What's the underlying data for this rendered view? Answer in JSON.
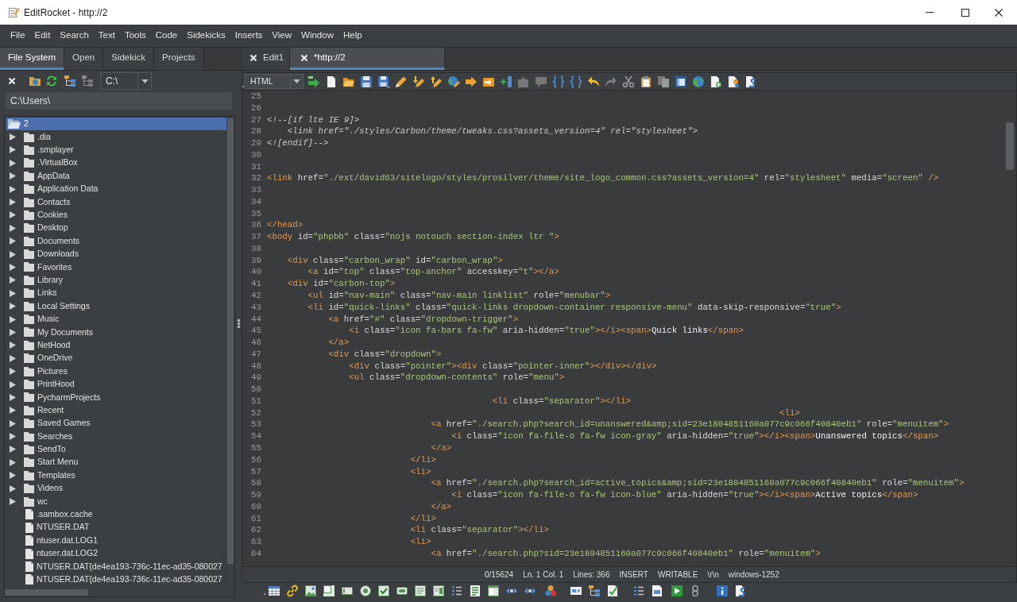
{
  "window": {
    "title": "EditRocket - http://2"
  },
  "menu": [
    "File",
    "Edit",
    "Search",
    "Text",
    "Tools",
    "Code",
    "Sidekicks",
    "Inserts",
    "View",
    "Window",
    "Help"
  ],
  "panel_tabs": [
    {
      "label": "File System",
      "selected": true
    },
    {
      "label": "Open",
      "selected": false
    },
    {
      "label": "Sidekick",
      "selected": false
    },
    {
      "label": "Projects",
      "selected": false
    }
  ],
  "editor_tabs": [
    {
      "label": "Edit1",
      "selected": false
    },
    {
      "label": "*http://2",
      "selected": true
    }
  ],
  "file_panel": {
    "drive": "C:\\",
    "path": "C:\\Users\\",
    "root": {
      "label": "2",
      "expanded": true,
      "selected": true,
      "children": [
        {
          "label": ".dia",
          "kind": "folder",
          "expanded": false,
          "selected": false
        },
        {
          "label": ".smplayer",
          "kind": "folder",
          "expanded": false,
          "selected": false
        },
        {
          "label": ".VirtualBox",
          "kind": "folder",
          "expanded": false,
          "selected": false
        },
        {
          "label": "AppData",
          "kind": "folder",
          "expanded": false,
          "selected": false
        },
        {
          "label": "Application Data",
          "kind": "folder",
          "expanded": false,
          "selected": false
        },
        {
          "label": "Contacts",
          "kind": "folder",
          "expanded": false,
          "selected": false
        },
        {
          "label": "Cookies",
          "kind": "folder",
          "expanded": false,
          "selected": false
        },
        {
          "label": "Desktop",
          "kind": "folder",
          "expanded": false,
          "selected": false
        },
        {
          "label": "Documents",
          "kind": "folder",
          "expanded": false,
          "selected": false
        },
        {
          "label": "Downloads",
          "kind": "folder",
          "expanded": false,
          "selected": false
        },
        {
          "label": "Favorites",
          "kind": "folder",
          "expanded": false,
          "selected": false
        },
        {
          "label": "Library",
          "kind": "folder",
          "expanded": false,
          "selected": false
        },
        {
          "label": "Links",
          "kind": "folder",
          "expanded": false,
          "selected": false
        },
        {
          "label": "Local Settings",
          "kind": "folder",
          "expanded": false,
          "selected": false
        },
        {
          "label": "Music",
          "kind": "folder",
          "expanded": false,
          "selected": false
        },
        {
          "label": "My Documents",
          "kind": "folder",
          "expanded": false,
          "selected": false
        },
        {
          "label": "NetHood",
          "kind": "folder",
          "expanded": false,
          "selected": false
        },
        {
          "label": "OneDrive",
          "kind": "folder",
          "expanded": false,
          "selected": false
        },
        {
          "label": "Pictures",
          "kind": "folder",
          "expanded": false,
          "selected": false
        },
        {
          "label": "PrintHood",
          "kind": "folder",
          "expanded": false,
          "selected": false
        },
        {
          "label": "PycharmProjects",
          "kind": "folder",
          "expanded": false,
          "selected": false
        },
        {
          "label": "Recent",
          "kind": "folder",
          "expanded": false,
          "selected": false
        },
        {
          "label": "Saved Games",
          "kind": "folder",
          "expanded": false,
          "selected": false
        },
        {
          "label": "Searches",
          "kind": "folder",
          "expanded": false,
          "selected": false
        },
        {
          "label": "SendTo",
          "kind": "folder",
          "expanded": false,
          "selected": false
        },
        {
          "label": "Start Menu",
          "kind": "folder",
          "expanded": false,
          "selected": false
        },
        {
          "label": "Templates",
          "kind": "folder",
          "expanded": false,
          "selected": false
        },
        {
          "label": "Videos",
          "kind": "folder",
          "expanded": false,
          "selected": false
        },
        {
          "label": "wc",
          "kind": "folder",
          "expanded": false,
          "selected": false
        },
        {
          "label": ".sambox.cache",
          "kind": "file",
          "selected": false
        },
        {
          "label": "NTUSER.DAT",
          "kind": "file",
          "selected": false
        },
        {
          "label": "ntuser.dat.LOG1",
          "kind": "file",
          "selected": false
        },
        {
          "label": "ntuser.dat.LOG2",
          "kind": "file",
          "selected": false
        },
        {
          "label": "NTUSER.DAT{de4ea193-736c-11ec-ad35-080027",
          "kind": "file",
          "selected": false
        },
        {
          "label": "NTUSER.DAT{de4ea193-736c-11ec-ad35-080027",
          "kind": "file",
          "selected": false
        }
      ]
    }
  },
  "editor": {
    "language": "HTML",
    "lines": [
      {
        "number": "25"
      },
      {
        "number": "26"
      },
      {
        "number": "27",
        "tokens": [
          {
            "kind": "comment",
            "text": "<!--[if lte IE 9]>"
          }
        ]
      },
      {
        "number": "28",
        "tokens": [
          {
            "kind": "comment",
            "text": "\t<link href=\"./styles/Carbon/theme/tweaks.css?assets_version=4\" rel=\"stylesheet\">"
          }
        ]
      },
      {
        "number": "29",
        "tokens": [
          {
            "kind": "comment",
            "text": "<![endif]-->"
          }
        ]
      },
      {
        "number": "30"
      },
      {
        "number": "31"
      },
      {
        "number": "32",
        "tokens": [
          {
            "kind": "tag",
            "text": "<link"
          },
          {
            "kind": "attr",
            "text": " href="
          },
          {
            "kind": "value",
            "text": "\"./ext/david63/sitelogo/styles/prosilver/theme/site_logo_common.css?assets_version=4\""
          },
          {
            "kind": "attr",
            "text": " rel="
          },
          {
            "kind": "value",
            "text": "\"stylesheet\""
          },
          {
            "kind": "attr",
            "text": " media="
          },
          {
            "kind": "value",
            "text": "\"screen\""
          },
          {
            "kind": "tag",
            "text": " />"
          }
        ]
      },
      {
        "number": "33"
      },
      {
        "number": "34"
      },
      {
        "number": "35"
      },
      {
        "number": "36",
        "tokens": [
          {
            "kind": "tag",
            "text": "</head>"
          }
        ]
      },
      {
        "number": "37",
        "tokens": [
          {
            "kind": "tag",
            "text": "<body"
          },
          {
            "kind": "attr",
            "text": " id="
          },
          {
            "kind": "value",
            "text": "\"phpbb\""
          },
          {
            "kind": "attr",
            "text": " class="
          },
          {
            "kind": "value",
            "text": "\"nojs notouch section-index ltr \""
          },
          {
            "kind": "tag",
            "text": ">"
          }
        ]
      },
      {
        "number": "38"
      },
      {
        "number": "39",
        "tokens": [
          {
            "kind": "tag",
            "text": "\t<div"
          },
          {
            "kind": "attr",
            "text": " class="
          },
          {
            "kind": "value",
            "text": "\"carbon_wrap\""
          },
          {
            "kind": "attr",
            "text": " id="
          },
          {
            "kind": "value",
            "text": "\"carbon_wrap\""
          },
          {
            "kind": "tag",
            "text": ">"
          }
        ]
      },
      {
        "number": "40",
        "tokens": [
          {
            "kind": "tag",
            "text": "\t\t<a"
          },
          {
            "kind": "attr",
            "text": " id="
          },
          {
            "kind": "value",
            "text": "\"top\""
          },
          {
            "kind": "attr",
            "text": " class="
          },
          {
            "kind": "value",
            "text": "\"top-anchor\""
          },
          {
            "kind": "attr",
            "text": " accesskey="
          },
          {
            "kind": "value",
            "text": "\"t\""
          },
          {
            "kind": "tag",
            "text": "></a>"
          }
        ]
      },
      {
        "number": "41",
        "tokens": [
          {
            "kind": "tag",
            "text": "\t<div"
          },
          {
            "kind": "attr",
            "text": " id="
          },
          {
            "kind": "value",
            "text": "\"carbon-top\""
          },
          {
            "kind": "tag",
            "text": ">"
          }
        ]
      },
      {
        "number": "42",
        "tokens": [
          {
            "kind": "tag",
            "text": "\t\t<ul"
          },
          {
            "kind": "attr",
            "text": " id="
          },
          {
            "kind": "value",
            "text": "\"nav-main\""
          },
          {
            "kind": "attr",
            "text": " class="
          },
          {
            "kind": "value",
            "text": "\"nav-main linklist\""
          },
          {
            "kind": "attr",
            "text": " role="
          },
          {
            "kind": "value",
            "text": "\"menubar\""
          },
          {
            "kind": "tag",
            "text": ">"
          }
        ]
      },
      {
        "number": "43",
        "tokens": [
          {
            "kind": "tag",
            "text": "\t\t<li"
          },
          {
            "kind": "attr",
            "text": " id="
          },
          {
            "kind": "value",
            "text": "\"quick-links\""
          },
          {
            "kind": "attr",
            "text": " class="
          },
          {
            "kind": "value",
            "text": "\"quick-links dropdown-container responsive-menu\""
          },
          {
            "kind": "attr",
            "text": " data-skip-responsive="
          },
          {
            "kind": "value",
            "text": "\"true\""
          },
          {
            "kind": "tag",
            "text": ">"
          }
        ]
      },
      {
        "number": "44",
        "tokens": [
          {
            "kind": "tag",
            "text": "\t\t\t<a"
          },
          {
            "kind": "attr",
            "text": " href="
          },
          {
            "kind": "value",
            "text": "\"#\""
          },
          {
            "kind": "attr",
            "text": " class="
          },
          {
            "kind": "value",
            "text": "\"dropdown-trigger\""
          },
          {
            "kind": "tag",
            "text": ">"
          }
        ]
      },
      {
        "number": "45",
        "tokens": [
          {
            "kind": "tag",
            "text": "\t\t\t\t<i"
          },
          {
            "kind": "attr",
            "text": " class="
          },
          {
            "kind": "value",
            "text": "\"icon fa-bars fa-fw\""
          },
          {
            "kind": "attr",
            "text": " aria-hidden="
          },
          {
            "kind": "value",
            "text": "\"true\""
          },
          {
            "kind": "tag",
            "text": "></i><span>"
          },
          {
            "kind": "text",
            "text": "Quick links"
          },
          {
            "kind": "tag",
            "text": "</span>"
          }
        ]
      },
      {
        "number": "46",
        "tokens": [
          {
            "kind": "tag",
            "text": "\t\t\t</a>"
          }
        ]
      },
      {
        "number": "47",
        "tokens": [
          {
            "kind": "tag",
            "text": "\t\t\t<div"
          },
          {
            "kind": "attr",
            "text": " class="
          },
          {
            "kind": "value",
            "text": "\"dropdown\""
          },
          {
            "kind": "tag",
            "text": ">"
          }
        ]
      },
      {
        "number": "48",
        "tokens": [
          {
            "kind": "tag",
            "text": "\t\t\t\t<div"
          },
          {
            "kind": "attr",
            "text": " class="
          },
          {
            "kind": "value",
            "text": "\"pointer\""
          },
          {
            "kind": "tag",
            "text": "><div"
          },
          {
            "kind": "attr",
            "text": " class="
          },
          {
            "kind": "value",
            "text": "\"pointer-inner\""
          },
          {
            "kind": "tag",
            "text": "></div></div>"
          }
        ]
      },
      {
        "number": "49",
        "tokens": [
          {
            "kind": "tag",
            "text": "\t\t\t\t<ul"
          },
          {
            "kind": "attr",
            "text": " class="
          },
          {
            "kind": "value",
            "text": "\"dropdown-contents\""
          },
          {
            "kind": "attr",
            "text": " role="
          },
          {
            "kind": "value",
            "text": "\"menu\""
          },
          {
            "kind": "tag",
            "text": ">"
          }
        ]
      },
      {
        "number": "50"
      },
      {
        "number": "51",
        "tokens": [
          {
            "kind": "tag",
            "text": "\t\t\t\t\t\t\t\t\t\t\t<li"
          },
          {
            "kind": "attr",
            "text": " class="
          },
          {
            "kind": "value",
            "text": "\"separator\""
          },
          {
            "kind": "tag",
            "text": "></li>"
          }
        ]
      },
      {
        "number": "52",
        "tokens": [
          {
            "kind": "tag",
            "text": "\t\t\t\t\t\t\t\t\t\t\t\t\t\t\t\t\t\t\t\t\t\t\t\t\t<li>"
          }
        ]
      },
      {
        "number": "53",
        "tokens": [
          {
            "kind": "tag",
            "text": "\t\t\t\t\t\t\t\t<a"
          },
          {
            "kind": "attr",
            "text": " href="
          },
          {
            "kind": "value",
            "text": "\"./search.php?search_id=unanswered&amp;sid=23e1804851160a077c9c066f40840eb1\""
          },
          {
            "kind": "attr",
            "text": " role="
          },
          {
            "kind": "value",
            "text": "\"menuitem\""
          },
          {
            "kind": "tag",
            "text": ">"
          }
        ]
      },
      {
        "number": "54",
        "tokens": [
          {
            "kind": "tag",
            "text": "\t\t\t\t\t\t\t\t\t<i"
          },
          {
            "kind": "attr",
            "text": " class="
          },
          {
            "kind": "value",
            "text": "\"icon fa-file-o fa-fw icon-gray\""
          },
          {
            "kind": "attr",
            "text": " aria-hidden="
          },
          {
            "kind": "value",
            "text": "\"true\""
          },
          {
            "kind": "tag",
            "text": "></i><span>"
          },
          {
            "kind": "text",
            "text": "Unanswered topics"
          },
          {
            "kind": "tag",
            "text": "</span>"
          }
        ]
      },
      {
        "number": "55",
        "tokens": [
          {
            "kind": "tag",
            "text": "\t\t\t\t\t\t\t\t</a>"
          }
        ]
      },
      {
        "number": "56",
        "tokens": [
          {
            "kind": "tag",
            "text": "\t\t\t\t\t\t\t</li>"
          }
        ]
      },
      {
        "number": "57",
        "tokens": [
          {
            "kind": "tag",
            "text": "\t\t\t\t\t\t\t<li>"
          }
        ]
      },
      {
        "number": "58",
        "tokens": [
          {
            "kind": "tag",
            "text": "\t\t\t\t\t\t\t\t<a"
          },
          {
            "kind": "attr",
            "text": " href="
          },
          {
            "kind": "value",
            "text": "\"./search.php?search_id=active_topics&amp;sid=23e1804851160a077c9c066f40840eb1\""
          },
          {
            "kind": "attr",
            "text": " role="
          },
          {
            "kind": "value",
            "text": "\"menuitem\""
          },
          {
            "kind": "tag",
            "text": ">"
          }
        ]
      },
      {
        "number": "59",
        "tokens": [
          {
            "kind": "tag",
            "text": "\t\t\t\t\t\t\t\t\t<i"
          },
          {
            "kind": "attr",
            "text": " class="
          },
          {
            "kind": "value",
            "text": "\"icon fa-file-o fa-fw icon-blue\""
          },
          {
            "kind": "attr",
            "text": " aria-hidden="
          },
          {
            "kind": "value",
            "text": "\"true\""
          },
          {
            "kind": "tag",
            "text": "></i><span>"
          },
          {
            "kind": "text",
            "text": "Active topics"
          },
          {
            "kind": "tag",
            "text": "</span>"
          }
        ]
      },
      {
        "number": "60",
        "tokens": [
          {
            "kind": "tag",
            "text": "\t\t\t\t\t\t\t\t</a>"
          }
        ]
      },
      {
        "number": "61",
        "tokens": [
          {
            "kind": "tag",
            "text": "\t\t\t\t\t\t\t</li>"
          }
        ]
      },
      {
        "number": "62",
        "tokens": [
          {
            "kind": "tag",
            "text": "\t\t\t\t\t\t\t<li"
          },
          {
            "kind": "attr",
            "text": " class="
          },
          {
            "kind": "value",
            "text": "\"separator\""
          },
          {
            "kind": "tag",
            "text": "></li>"
          }
        ]
      },
      {
        "number": "63",
        "tokens": [
          {
            "kind": "tag",
            "text": "\t\t\t\t\t\t\t<li>"
          }
        ]
      },
      {
        "number": "64",
        "tokens": [
          {
            "kind": "tag",
            "text": "\t\t\t\t\t\t\t\t<a"
          },
          {
            "kind": "attr",
            "text": " href="
          },
          {
            "kind": "value",
            "text": "\"./search.php?sid=23e1804851160a077c9c066f40840eb1\""
          },
          {
            "kind": "attr",
            "text": " role="
          },
          {
            "kind": "value",
            "text": "\"menuitem\""
          },
          {
            "kind": "tag",
            "text": ">"
          }
        ]
      }
    ]
  },
  "status_bar": [
    "0/15624",
    "Ln. 1 Col. 1",
    "Lines: 366",
    "INSERT",
    "WRITABLE",
    "\\r\\n",
    "windows-1252"
  ]
}
